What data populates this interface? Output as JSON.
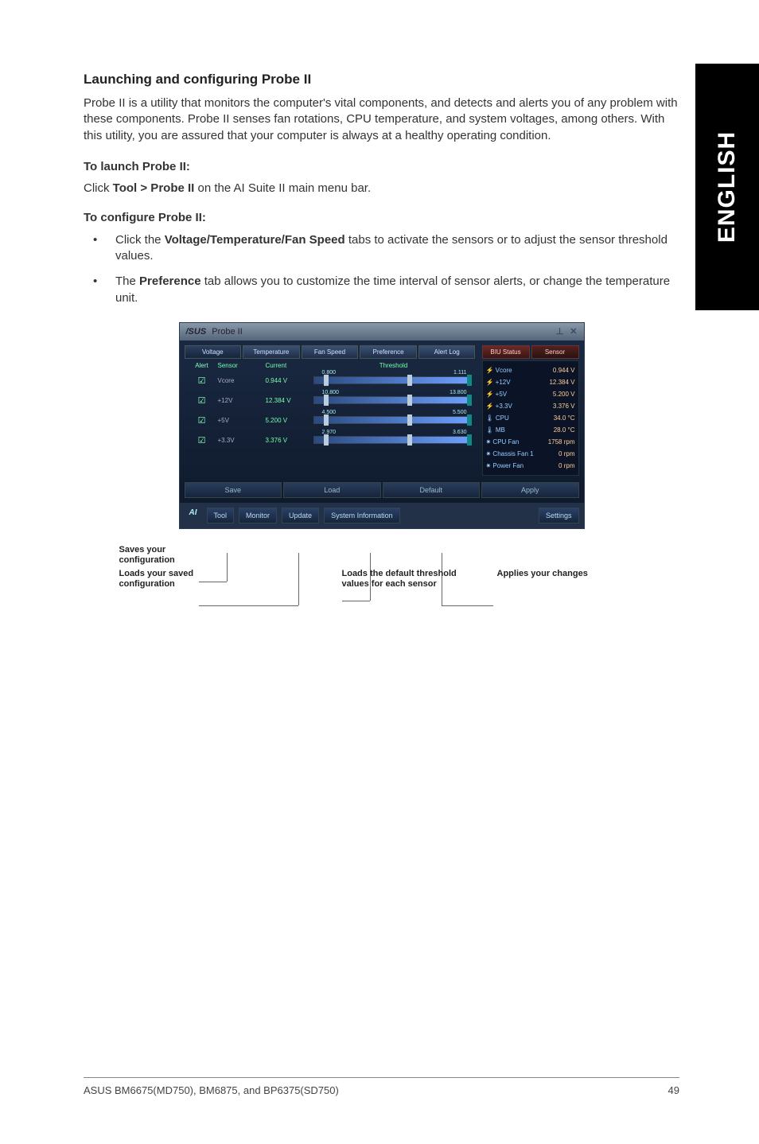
{
  "side_tab": "ENGLISH",
  "heading": "Launching and configuring Probe II",
  "intro": "Probe II is a utility that monitors the computer's vital components, and detects and alerts you of any problem with these components. Probe II senses fan rotations, CPU temperature, and system voltages, among others. With this utility, you are assured that your computer is always at a healthy operating condition.",
  "launch_head": "To launch Probe II:",
  "launch_text_pre": "Click ",
  "launch_text_bold": "Tool > Probe II",
  "launch_text_post": " on the AI Suite II main menu bar.",
  "config_head": "To configure Probe II:",
  "bullet1_pre": "Click the ",
  "bullet1_bold": "Voltage/Temperature/Fan Speed",
  "bullet1_post": " tabs to activate the sensors or to adjust the sensor threshold values.",
  "bullet2_pre": "The ",
  "bullet2_bold": "Preference",
  "bullet2_post": " tab allows you to customize the time interval of sensor alerts, or change the temperature unit.",
  "app": {
    "title_brand": "/SUS",
    "title_name": "Probe II",
    "tabs": [
      "Voltage",
      "Temperature",
      "Fan Speed",
      "Preference",
      "Alert Log"
    ],
    "col_alert": "Alert",
    "col_sensor": "Sensor",
    "col_current": "Current",
    "col_threshold": "Threshold",
    "rows": [
      {
        "name": "Vcore",
        "val": "0.944 V",
        "low": "0.800",
        "high": "1.111"
      },
      {
        "name": "+12V",
        "val": "12.384 V",
        "low": "10.800",
        "high": "13.800"
      },
      {
        "name": "+5V",
        "val": "5.200 V",
        "low": "4.500",
        "high": "5.500"
      },
      {
        "name": "+3.3V",
        "val": "3.376 V",
        "low": "2.970",
        "high": "3.630"
      }
    ],
    "status_tabs": [
      "BIU Status",
      "Sensor"
    ],
    "status": [
      {
        "n": "⚡ Vcore",
        "v": "0.944 V"
      },
      {
        "n": "⚡ +12V",
        "v": "12.384 V"
      },
      {
        "n": "⚡ +5V",
        "v": "5.200 V"
      },
      {
        "n": "⚡ +3.3V",
        "v": "3.376 V"
      },
      {
        "n": "🌡 CPU",
        "v": "34.0 °C"
      },
      {
        "n": "🌡 MB",
        "v": "28.0 °C"
      },
      {
        "n": "✷ CPU Fan",
        "v": "1758 rpm"
      },
      {
        "n": "✷ Chassis Fan 1",
        "v": "0 rpm"
      },
      {
        "n": "✷ Power Fan",
        "v": "0 rpm"
      }
    ],
    "bottom": [
      "Save",
      "Load",
      "Default",
      "Apply"
    ],
    "footer": [
      "Tool",
      "Monitor",
      "Update",
      "System Information",
      "Settings"
    ]
  },
  "callout_save": "Saves your configuration",
  "callout_load": "Loads your saved configuration",
  "callout_default": "Loads the default threshold values for each sensor",
  "callout_apply": "Applies your changes",
  "footer_left": "ASUS BM6675(MD750), BM6875, and BP6375(SD750)",
  "footer_right": "49"
}
